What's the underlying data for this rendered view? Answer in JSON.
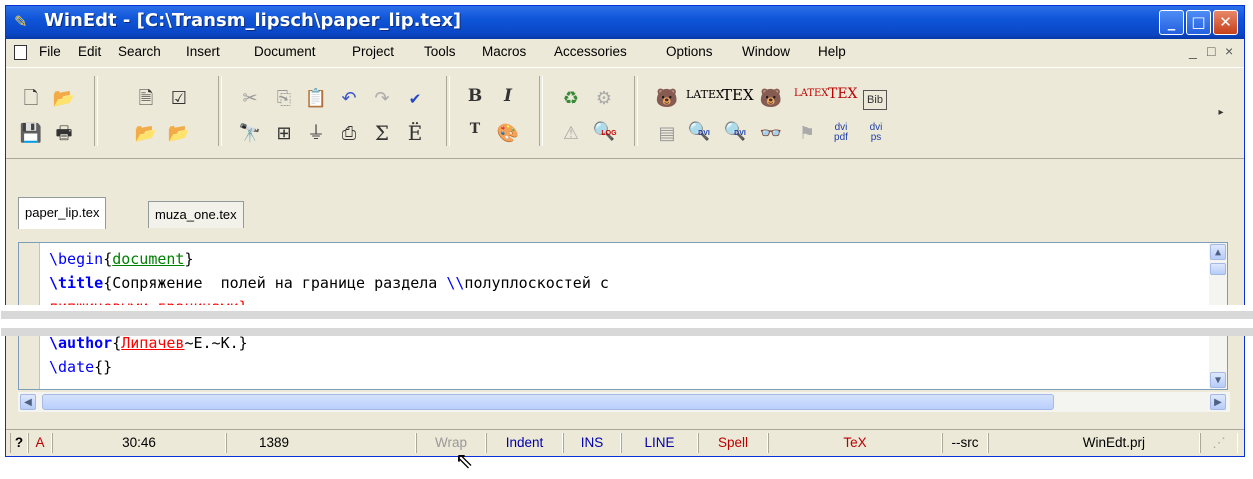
{
  "window": {
    "title": "WinEdt - [C:\\Transm_lipsch\\paper_lip.tex]",
    "app_icon": "winedt-pen-icon",
    "controls": [
      "minimize",
      "maximize",
      "close"
    ]
  },
  "menu": {
    "items": [
      "File",
      "Edit",
      "Search",
      "Insert",
      "Document",
      "Project",
      "Tools",
      "Macros",
      "Accessories",
      "Options",
      "Window",
      "Help"
    ],
    "mdi_controls": [
      "_",
      "□",
      "×"
    ]
  },
  "toolbar": {
    "row1_icons": [
      "new-file-icon",
      "open-folder-icon",
      "document-icon",
      "checklist-icon",
      "cut-icon",
      "copy-icon",
      "paste-icon",
      "undo-icon",
      "redo-icon",
      "spellcheck-icon",
      "bold-icon",
      "italic-icon",
      "recycle-icon",
      "gears-icon",
      "bear-icon",
      "latex-icon",
      "tex-icon",
      "color-bear-icon",
      "pdf-latex-icon",
      "pdf-tex-icon",
      "bibtex-icon"
    ],
    "row2_icons": [
      "save-icon",
      "print-icon",
      "open-green-icon",
      "open-gray-icon",
      "find-icon",
      "tree-icon",
      "filter-icon",
      "insert-icon",
      "sum-icon",
      "umlaut-icon",
      "typewriter-icon",
      "palette-icon",
      "warning-icon",
      "log-search-icon",
      "terminal-icon",
      "dvi-preview-icon",
      "dvi-search-icon",
      "glasses-icon",
      "acrobat-icon",
      "dvi-pdf-icon",
      "dvi-ps-icon"
    ],
    "labels": {
      "bold": "B",
      "italic": "I",
      "sum": "Σ",
      "umlaut": "Ë",
      "typewriter": "T",
      "latex": "LATEX",
      "tex": "TEX",
      "bib": "Bib",
      "dvi_pdf": "dvi pdf",
      "dvi_ps": "dvi ps",
      "log": "LOG",
      "dvi": "DVI"
    }
  },
  "tabs": [
    {
      "label": "paper_lip.tex",
      "active": true
    },
    {
      "label": "muza_one.tex",
      "active": false
    }
  ],
  "editor": {
    "line1": {
      "cmd": "\\begin",
      "open": "{",
      "arg": "document",
      "close": "}"
    },
    "line2": {
      "cmd": "\\title",
      "open": "{",
      "text": "Сопряжение  полей на границе раздела ",
      "break": "\\\\",
      "text2": "полуплоскостей с"
    },
    "line3": {
      "text": "липшицевыми границами}"
    },
    "line4": {
      "cmd": "\\author",
      "open": "{",
      "name": "Липачев",
      "rest": "~Е.~К.}"
    },
    "line5": {
      "cmd": "\\date",
      "args": "{}"
    }
  },
  "statusbar": {
    "help": "?",
    "mode": "A",
    "position": "30:46",
    "lines": "1389",
    "wrap": "Wrap",
    "indent": "Indent",
    "ins": "INS",
    "line": "LINE",
    "spell": "Spell",
    "tex": "TeX",
    "src": "--src",
    "project": "WinEdt.prj"
  },
  "colors": {
    "titlebar": "#0a46c4",
    "command": "#0000ff",
    "bracket_arg": "#008000",
    "error": "#ff0000"
  }
}
